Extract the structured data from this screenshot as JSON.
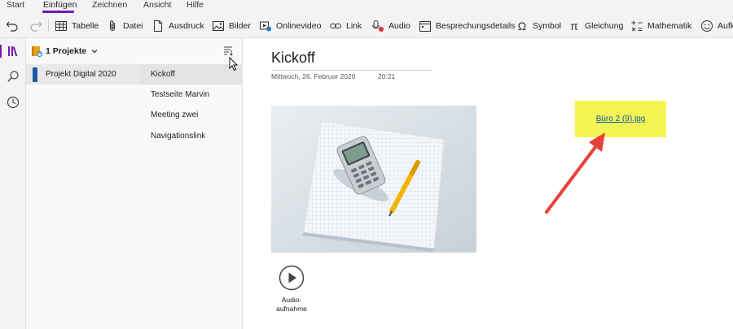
{
  "menu": {
    "tabs": [
      {
        "label": "Start"
      },
      {
        "label": "Einfügen"
      },
      {
        "label": "Zeichnen"
      },
      {
        "label": "Ansicht"
      },
      {
        "label": "Hilfe"
      }
    ],
    "active_tab": "Einfügen"
  },
  "ribbon": {
    "items": [
      {
        "label": "Tabelle",
        "icon": "table-icon"
      },
      {
        "label": "Datei",
        "icon": "paperclip-icon"
      },
      {
        "label": "Ausdruck",
        "icon": "document-icon"
      },
      {
        "label": "Bilder",
        "icon": "image-icon"
      },
      {
        "label": "Onlinevideo",
        "icon": "online-video-icon"
      },
      {
        "label": "Link",
        "icon": "link-icon"
      },
      {
        "label": "Audio",
        "icon": "audio-record-icon"
      },
      {
        "label": "Besprechungsdetails",
        "icon": "calendar-icon"
      },
      {
        "label": "Symbol",
        "icon": "omega-icon"
      },
      {
        "label": "Gleichung",
        "icon": "pi-icon"
      },
      {
        "label": "Mathematik",
        "icon": "math-icon"
      },
      {
        "label": "Aufk",
        "icon": "sticker-icon"
      }
    ],
    "undo_icon": "undo-icon",
    "redo_icon": "redo-icon"
  },
  "notebook": {
    "name": "1 Projekte",
    "sections": [
      {
        "label": "Projekt Digital 2020",
        "color": "#1e5aa8"
      }
    ],
    "pages": [
      {
        "label": "Kickoff"
      },
      {
        "label": "Testseite Marvin"
      },
      {
        "label": "Meeting zwei"
      },
      {
        "label": "Navigationslink"
      }
    ]
  },
  "page": {
    "title": "Kickoff",
    "date": "Mittwoch, 26. Februar 2020",
    "time": "20:21",
    "audio_label_1": "Audio-",
    "audio_label_2": "aufnahme",
    "attachment": "Büro 2 (9).jpg"
  },
  "colors": {
    "accent": "#7719aa",
    "attachment_bg": "#f5f552",
    "annotation_arrow": "#e8413c"
  }
}
